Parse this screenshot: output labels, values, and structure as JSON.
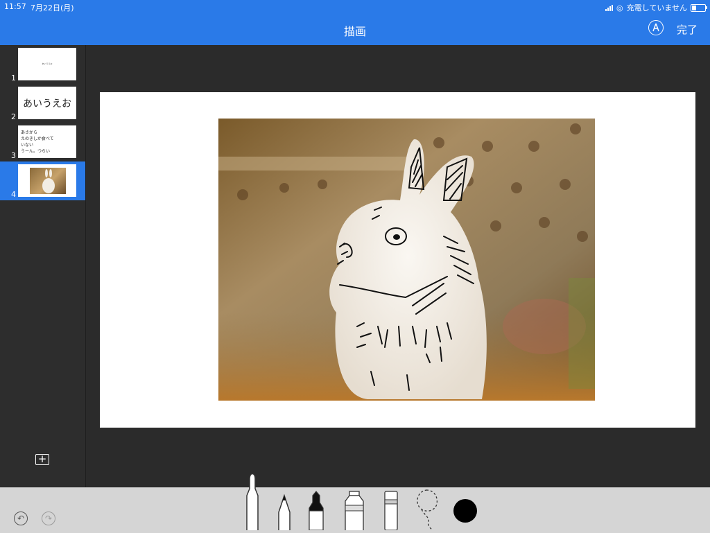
{
  "status": {
    "time": "11:57",
    "date": "7月22日(月)",
    "charging": "充電していません",
    "battery_level": 0.35
  },
  "nav": {
    "title": "描画",
    "done": "完了",
    "pen_icon": "pencil-tip-circle-icon"
  },
  "slides": [
    {
      "num": "1",
      "text": "あいうえお"
    },
    {
      "num": "2",
      "text": "あいうえお"
    },
    {
      "num": "3",
      "lines": [
        "あさから",
        "えのきしか食べて",
        "いない",
        "うーん。つらい"
      ]
    },
    {
      "num": "4",
      "image": "rabbit-photo"
    }
  ],
  "active_slide": "4",
  "tools": [
    "marker",
    "pencil",
    "crayon",
    "paint-tube",
    "eraser",
    "lasso"
  ],
  "current_color": "#000000",
  "accent": "#2a7ae8"
}
